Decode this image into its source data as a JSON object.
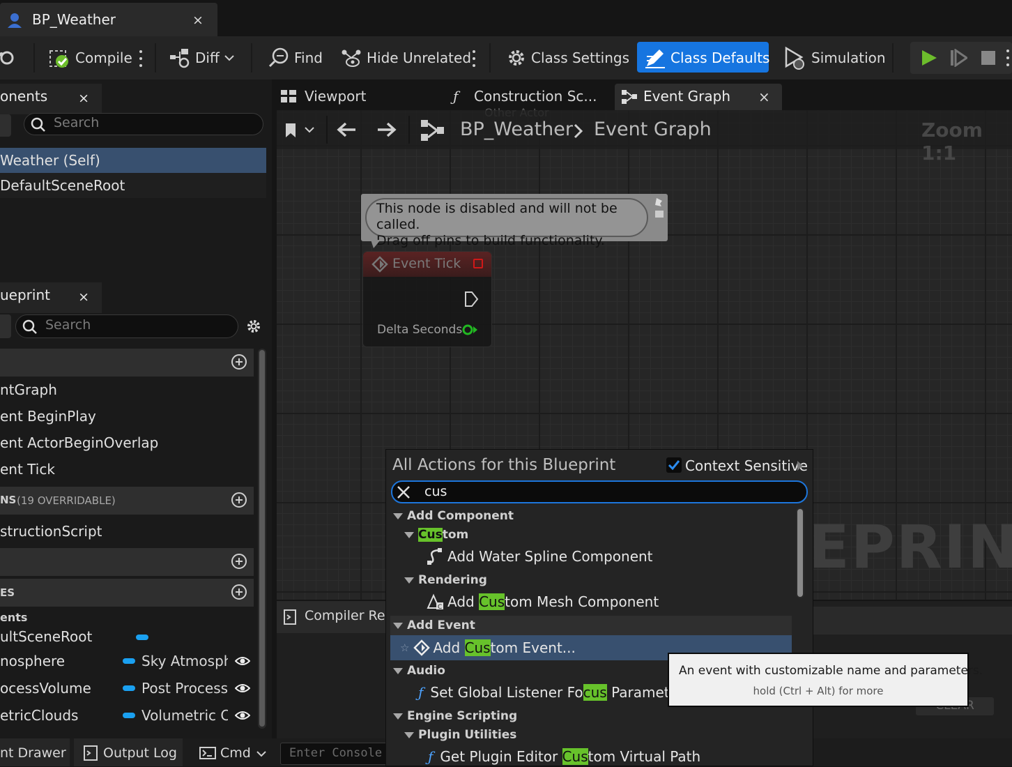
{
  "window": {
    "tab_title": "BP_Weather",
    "close_glyph": "×"
  },
  "toolbar": {
    "compile": "Compile",
    "diff": "Diff",
    "find": "Find",
    "hide_unrelated": "Hide Unrelated",
    "class_settings": "Class Settings",
    "class_defaults": "Class Defaults",
    "simulation": "Simulation"
  },
  "components_panel": {
    "tab": "onents",
    "search_placeholder": "Search",
    "items": [
      "Weather (Self)",
      "DefaultSceneRoot"
    ]
  },
  "blueprint_panel": {
    "tab": "ueprint",
    "search_placeholder": "Search",
    "graph_items": [
      "ntGraph",
      "ent BeginPlay",
      "ent ActorBeginOverlap",
      "ent Tick"
    ],
    "functions_header": "NS",
    "functions_count": "(19 OVERRIDABLE)",
    "function_items": [
      "structionScript"
    ],
    "variables_header": "ES",
    "variables_group": "ents",
    "variables": [
      {
        "name": "ultSceneRoot",
        "type": "",
        "has_eye": false
      },
      {
        "name": "nosphere",
        "type": "Sky Atmosphe",
        "has_eye": true
      },
      {
        "name": "ocessVolume",
        "type": "Post Process",
        "has_eye": true
      },
      {
        "name": "etricClouds",
        "type": "Volumetric Cl",
        "has_eye": true
      }
    ]
  },
  "editor_tabs": {
    "viewport": "Viewport",
    "construction": "Construction Sc...",
    "event_graph": "Event Graph"
  },
  "graph": {
    "breadcrumb_root": "BP_Weather",
    "breadcrumb_current": "Event Graph",
    "zoom": "Zoom 1:1",
    "faded_pin": "Other Actor",
    "watermark": "EPRINT",
    "comment_line1": "This node is disabled and will not be called.",
    "comment_line2": "Drag off pins to build functionality.",
    "node_title": "Event Tick",
    "node_pin": "Delta Seconds"
  },
  "compiler": {
    "tab": "Compiler Res",
    "clear": "CLEAR"
  },
  "bottom": {
    "content_drawer": "nt Drawer",
    "output_log": "Output Log",
    "cmd": "Cmd",
    "console_placeholder": "Enter Console"
  },
  "action_menu": {
    "title": "All Actions for this Blueprint",
    "context_sensitive": "Context Sensitive",
    "query": "cus",
    "cat_add_component": "Add Component",
    "sub_custom_hl": "Cus",
    "sub_custom_rest": "tom",
    "item_water_spline": "Add Water Spline Component",
    "sub_rendering": "Rendering",
    "item_mesh_pre": "Add ",
    "item_mesh_hl": "Cus",
    "item_mesh_post": "tom Mesh Component",
    "cat_add_event": "Add Event",
    "item_event_pre": "Add ",
    "item_event_hl": "Cus",
    "item_event_post": "tom Event...",
    "cat_audio": "Audio",
    "item_audio_pre": "Set Global Listener Fo",
    "item_audio_hl": "cus",
    "item_audio_post": " Parameters",
    "cat_engine_scripting": "Engine Scripting",
    "sub_plugin_utilities": "Plugin Utilities",
    "item_plugin_pre": "Get Plugin Editor ",
    "item_plugin_hl": "Cus",
    "item_plugin_post": "tom Virtual Path"
  },
  "tooltip": {
    "text": "An event with customizable name and parameters.",
    "hint": "hold (Ctrl + Alt) for more"
  },
  "colors": {
    "accent_blue": "#1675e0",
    "highlight_green": "#67c22b",
    "play_green": "#6dbd2c",
    "var_pill": "#1aa0f0"
  }
}
